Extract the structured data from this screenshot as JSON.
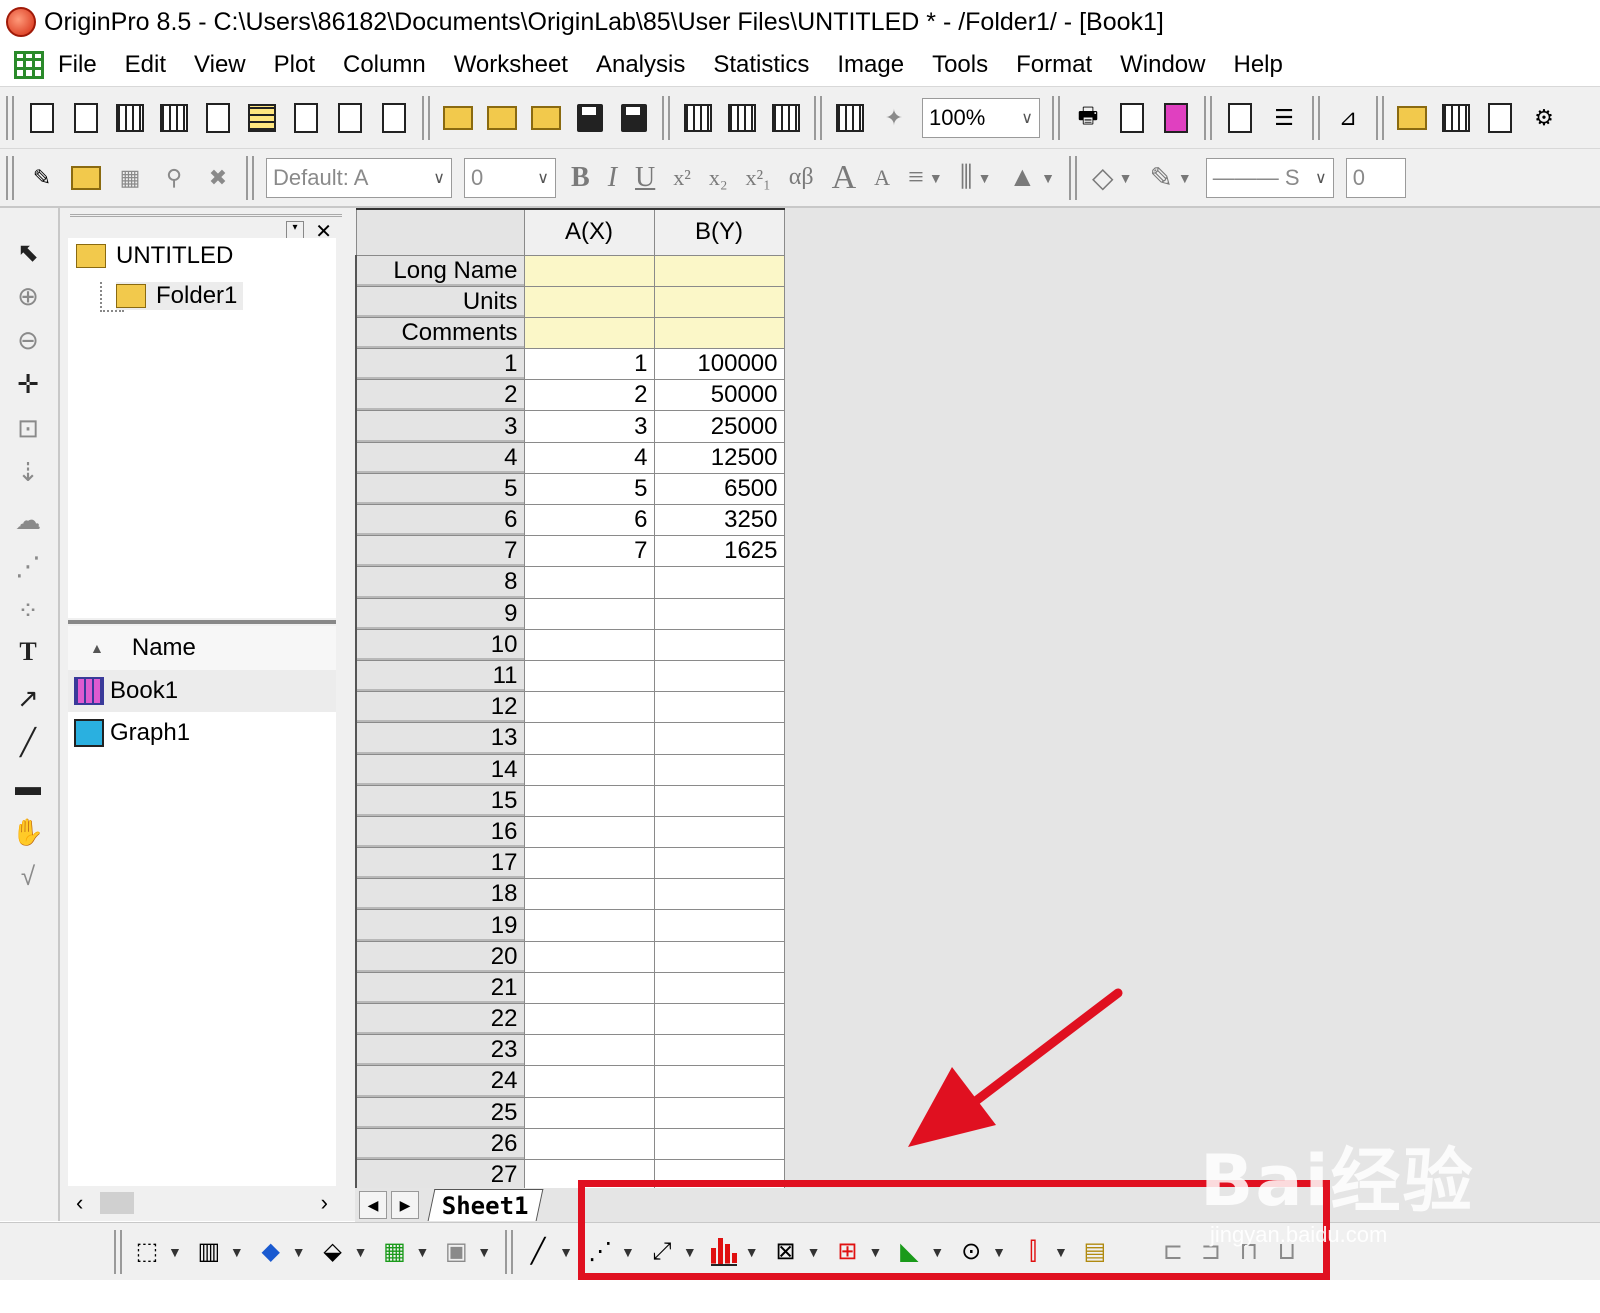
{
  "window": {
    "title": "OriginPro 8.5 - C:\\Users\\86182\\Documents\\OriginLab\\85\\User Files\\UNTITLED * - /Folder1/ - [Book1]"
  },
  "menu": [
    "File",
    "Edit",
    "View",
    "Plot",
    "Column",
    "Worksheet",
    "Analysis",
    "Statistics",
    "Image",
    "Tools",
    "Format",
    "Window",
    "Help"
  ],
  "toolbar": {
    "zoom": "100%"
  },
  "format_toolbar": {
    "font": "Default: A",
    "size": "0",
    "bold": "B",
    "italic": "I",
    "underline": "U",
    "superscript": "x²",
    "subscript": "x₂",
    "supsub": "x²₁",
    "greek": "αβ",
    "grow": "A",
    "shrink": "A",
    "line_style": "——— S",
    "line_width": "0"
  },
  "explorer": {
    "root": "UNTITLED",
    "folder": "Folder1",
    "name_header": "Name",
    "files": [
      "Book1",
      "Graph1"
    ]
  },
  "worksheet": {
    "columns": [
      "A(X)",
      "B(Y)"
    ],
    "meta_rows": [
      "Long Name",
      "Units",
      "Comments"
    ],
    "rows": [
      [
        "1",
        "1",
        "100000"
      ],
      [
        "2",
        "2",
        "50000"
      ],
      [
        "3",
        "3",
        "25000"
      ],
      [
        "4",
        "4",
        "12500"
      ],
      [
        "5",
        "5",
        "6500"
      ],
      [
        "6",
        "6",
        "3250"
      ],
      [
        "7",
        "7",
        "1625"
      ],
      [
        "8",
        "",
        ""
      ],
      [
        "9",
        "",
        ""
      ],
      [
        "10",
        "",
        ""
      ],
      [
        "11",
        "",
        ""
      ],
      [
        "12",
        "",
        ""
      ],
      [
        "13",
        "",
        ""
      ],
      [
        "14",
        "",
        ""
      ],
      [
        "15",
        "",
        ""
      ],
      [
        "16",
        "",
        ""
      ],
      [
        "17",
        "",
        ""
      ],
      [
        "18",
        "",
        ""
      ],
      [
        "19",
        "",
        ""
      ],
      [
        "20",
        "",
        ""
      ],
      [
        "21",
        "",
        ""
      ],
      [
        "22",
        "",
        ""
      ],
      [
        "23",
        "",
        ""
      ],
      [
        "24",
        "",
        ""
      ],
      [
        "25",
        "",
        ""
      ],
      [
        "26",
        "",
        ""
      ],
      [
        "27",
        "",
        ""
      ]
    ],
    "sheet_tab": "Sheet1"
  },
  "watermark": {
    "brand": "Bai经验",
    "url": "jingyan.baidu.com"
  },
  "colors": {
    "annotation": "#e01020",
    "meta_row_bg": "#fbf7c8",
    "mdi_bg": "#e5e5e5"
  }
}
